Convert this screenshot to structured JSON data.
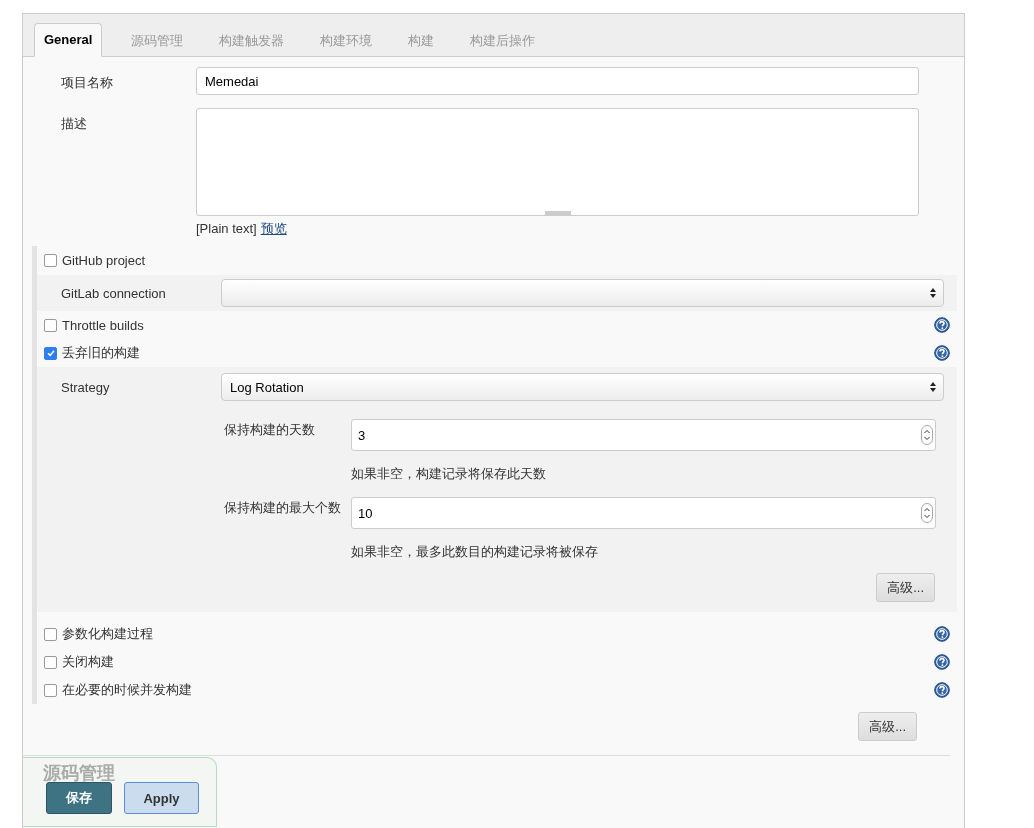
{
  "tabs": [
    {
      "label": "General",
      "selected": true
    },
    {
      "label": "源码管理",
      "selected": false
    },
    {
      "label": "构建触发器",
      "selected": false
    },
    {
      "label": "构建环境",
      "selected": false
    },
    {
      "label": "构建",
      "selected": false
    },
    {
      "label": "构建后操作",
      "selected": false
    }
  ],
  "project_name": {
    "label": "项目名称",
    "value": "Memedai"
  },
  "description": {
    "label": "描述"
  },
  "format_note": {
    "text": "[Plain text]",
    "link": "预览"
  },
  "options": [
    {
      "kind": "checkbox",
      "label": "GitHub project",
      "checked": false,
      "help": false
    },
    {
      "kind": "select",
      "label": "GitLab connection"
    },
    {
      "kind": "checkbox",
      "label": "Throttle builds",
      "checked": false,
      "help": true
    },
    {
      "kind": "checkbox",
      "label": "丢弃旧的构建",
      "checked": true,
      "help": true,
      "details": {
        "strategy": {
          "label": "Strategy",
          "value": "Log Rotation"
        },
        "fields": [
          {
            "label": "保持构建的天数",
            "value": "3",
            "hint": "如果非空，构建记录将保存此天数"
          },
          {
            "label": "保持构建的最大个数",
            "value": "10",
            "hint": "如果非空，最多此数目的构建记录将被保存"
          }
        ],
        "advanced_button": "高级..."
      }
    },
    {
      "kind": "checkbox",
      "label": "参数化构建过程",
      "checked": false,
      "help": true
    },
    {
      "kind": "checkbox",
      "label": "关闭构建",
      "checked": false,
      "help": true
    },
    {
      "kind": "checkbox",
      "label": "在必要的时候并发构建",
      "checked": false,
      "help": true
    }
  ],
  "advanced_button": "高级...",
  "section_heading": "源码管理",
  "buttons": [
    {
      "label": "保存",
      "kind": "primary"
    },
    {
      "label": "Apply",
      "kind": "secondary"
    }
  ]
}
